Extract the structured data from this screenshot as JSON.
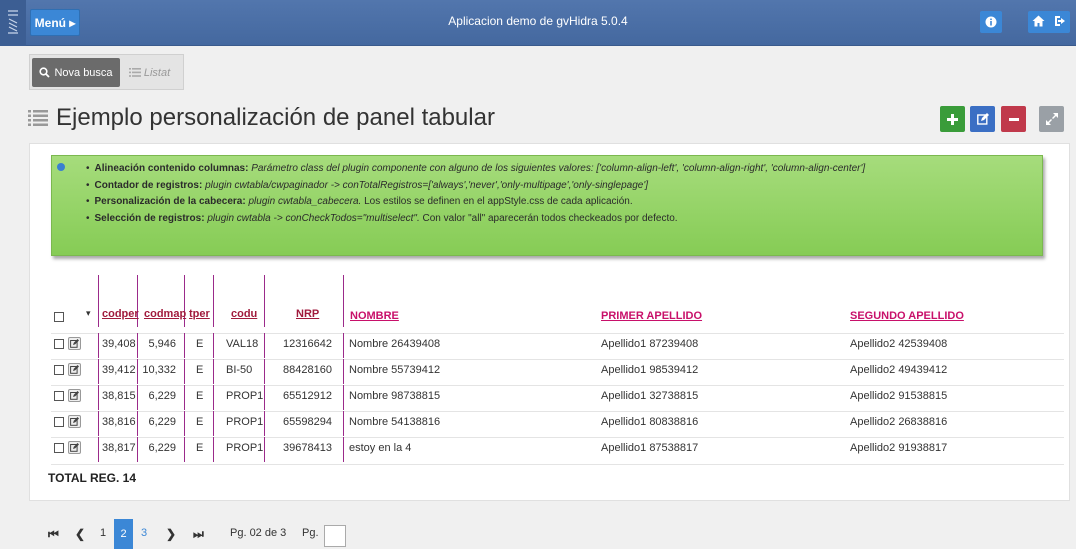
{
  "header": {
    "menu_label": "Menú ▸",
    "app_title": "Aplicacion demo de gvHidra 5.0.4"
  },
  "toolbar": {
    "nova_busca_label": "Nova busca",
    "listat_label": "Listat"
  },
  "page": {
    "title": "Ejemplo personalización de panel tabular"
  },
  "colors": {
    "navbar": "#4a6fa5",
    "accent_blue": "#3b87d6",
    "add_green": "#3a9c3a",
    "delete_red": "#c0394b",
    "info_green": "#8fd35f",
    "header_link": "#a01a3c"
  },
  "info": {
    "items": [
      {
        "bold": "Alineación contenido columnas:",
        "italic": "Parámetro class del plugin componente con alguno de los siguientes valores: ['column-align-left', 'column-align-right', 'column-align-center']",
        "rest": ""
      },
      {
        "bold": "Contador de registros:",
        "italic": "plugin cwtabla/cwpaginador -> conTotalRegistros=['always','never','only-multipage','only-singlepage']",
        "rest": ""
      },
      {
        "bold": "Personalización de la cabecera:",
        "italic": "plugin cwtabla_cabecera.",
        "rest": " Los estilos se definen en el appStyle.css de cada aplicación."
      },
      {
        "bold": "Selección de registros:",
        "italic": "plugin cwtabla -> conCheckTodos=\"multiselect\".",
        "rest": " Con valor \"all\" aparecerán todos checkeados por defecto."
      }
    ]
  },
  "table": {
    "headers": {
      "codper": "codper",
      "codmap": "codmap",
      "tper": "tper",
      "codu": "codu",
      "nrp": "NRP",
      "nombre": "NOMBRE",
      "apellido1": "PRIMER APELLIDO",
      "apellido2": "SEGUNDO APELLIDO"
    },
    "rows": [
      {
        "codper": "39,408",
        "codmap": "5,946",
        "tper": "E",
        "codu": "VAL18",
        "nrp": "12316642",
        "nombre": "Nombre 26439408",
        "apellido1": "Apellido1 87239408",
        "apellido2": "Apellido2 42539408"
      },
      {
        "codper": "39,412",
        "codmap": "10,332",
        "tper": "E",
        "codu": "BI-50",
        "nrp": "88428160",
        "nombre": "Nombre 55739412",
        "apellido1": "Apellido1 98539412",
        "apellido2": "Apellido2 49439412"
      },
      {
        "codper": "38,815",
        "codmap": "6,229",
        "tper": "E",
        "codu": "PROP1",
        "nrp": "65512912",
        "nombre": "Nombre 98738815",
        "apellido1": "Apellido1 32738815",
        "apellido2": "Apellido2 91538815"
      },
      {
        "codper": "38,816",
        "codmap": "6,229",
        "tper": "E",
        "codu": "PROP1",
        "nrp": "65598294",
        "nombre": "Nombre 54138816",
        "apellido1": "Apellido1 80838816",
        "apellido2": "Apellido2 26838816"
      },
      {
        "codper": "38,817",
        "codmap": "6,229",
        "tper": "E",
        "codu": "PROP1",
        "nrp": "39678413",
        "nombre": "estoy en la 4",
        "apellido1": "Apellido1 87538817",
        "apellido2": "Apellido2 91938817"
      }
    ],
    "total_label": "TOTAL REG. 14"
  },
  "pagination": {
    "first": "⏮",
    "pages": [
      "1",
      "2",
      "3"
    ],
    "active_page": "2",
    "page_info": "Pg. 02 de 3",
    "goto_label": "Pg."
  }
}
